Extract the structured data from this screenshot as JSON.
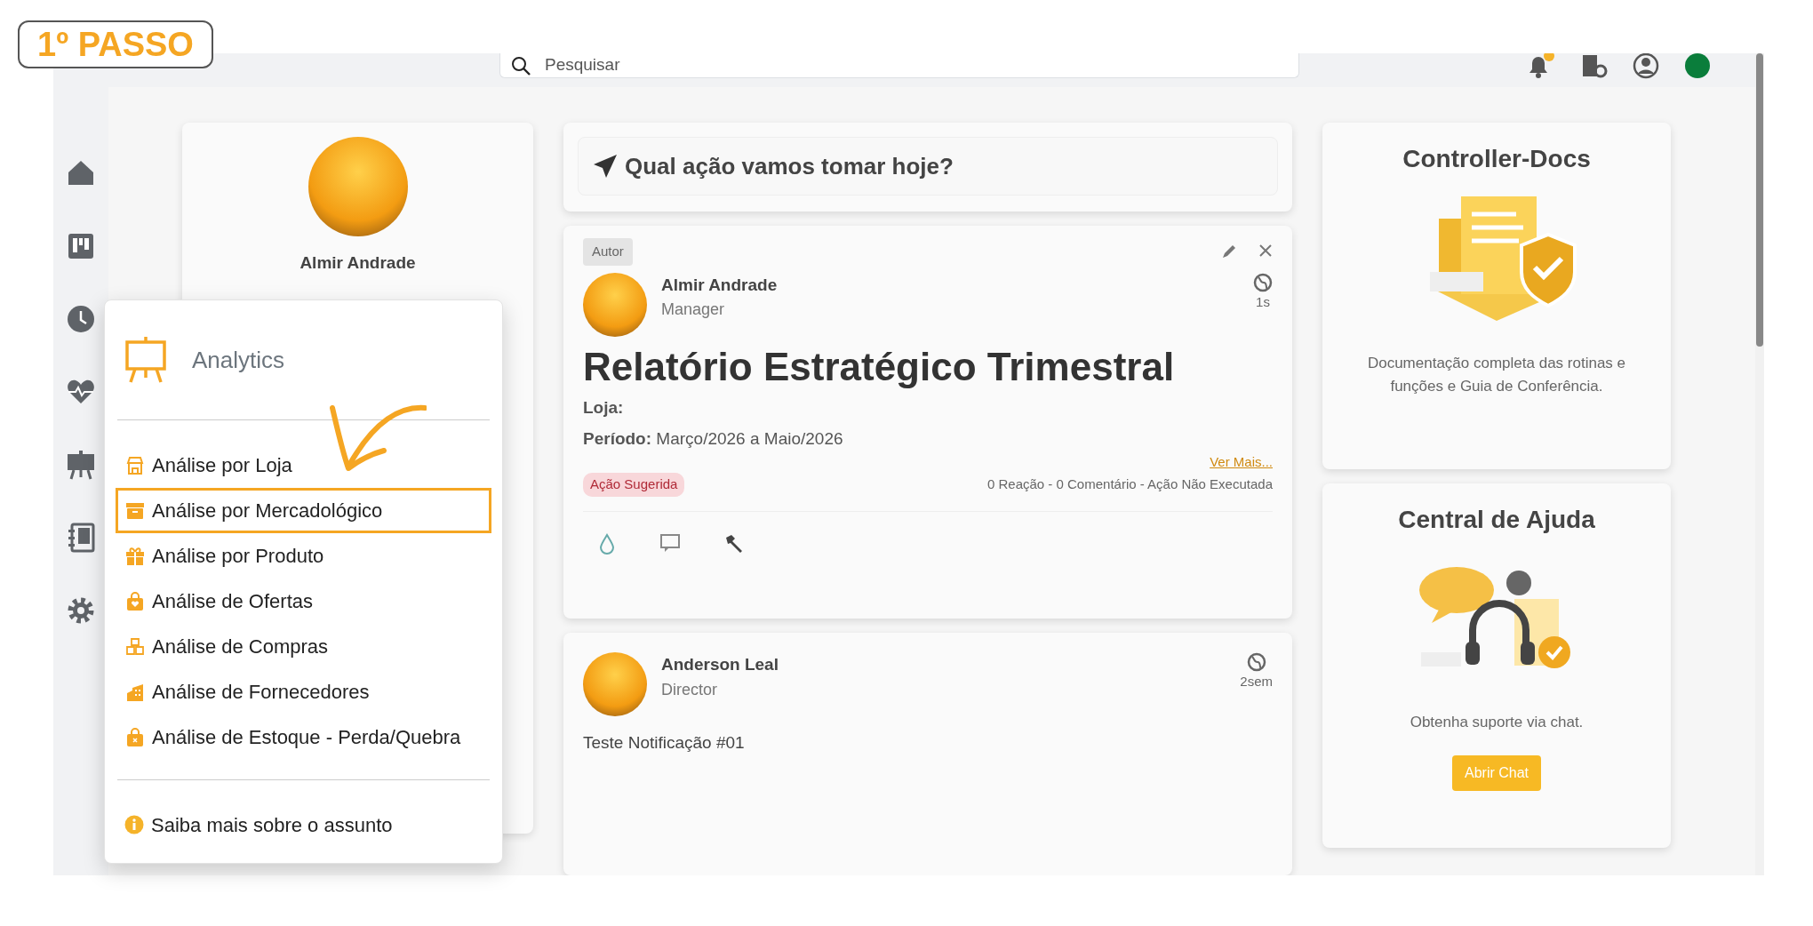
{
  "step_badge": {
    "text": "1º PASSO"
  },
  "topbar": {
    "search": {
      "placeholder": "Pesquisar"
    }
  },
  "profile_card": {
    "name": "Almir Andrade"
  },
  "prompt": {
    "text": "Qual ação vamos tomar hoje?"
  },
  "posts": [
    {
      "tag": "Autor",
      "author": "Almir Andrade",
      "role": "Manager",
      "time": "1s",
      "title": "Relatório Estratégico Trimestral",
      "fields": [
        {
          "label": "Loja:"
        },
        {
          "label": "Período:",
          "value": "Março/2026 a Maio/2026"
        }
      ],
      "more_link": "Ver Mais...",
      "status_tag": "Ação Sugerida",
      "stats": "0 Reação - 0 Comentário - Ação Não Executada"
    },
    {
      "author": "Anderson Leal",
      "role": "Director",
      "time": "2sem",
      "body": "Teste Notificação #01"
    }
  ],
  "side_cards": [
    {
      "kind": "docs",
      "title": "Controller-Docs",
      "text": "Documentação completa das rotinas e funções e Guia de Conferência."
    },
    {
      "kind": "help",
      "title": "Central de Ajuda",
      "text": "Obtenha suporte via chat.",
      "button": "Abrir Chat"
    }
  ],
  "menu": {
    "title": "Analytics",
    "items": [
      {
        "label": "Análise por Loja",
        "highlighted": false
      },
      {
        "label": "Análise por Mercadológico",
        "highlighted": true
      },
      {
        "label": "Análise por Produto",
        "highlighted": false
      },
      {
        "label": "Análise de Ofertas",
        "highlighted": false
      },
      {
        "label": "Análise de Compras",
        "highlighted": false
      },
      {
        "label": "Análise de Fornecedores",
        "highlighted": false
      },
      {
        "label": "Análise de Estoque - Perda/Quebra",
        "highlighted": false
      }
    ],
    "footer": "Saiba mais sobre o assunto"
  }
}
